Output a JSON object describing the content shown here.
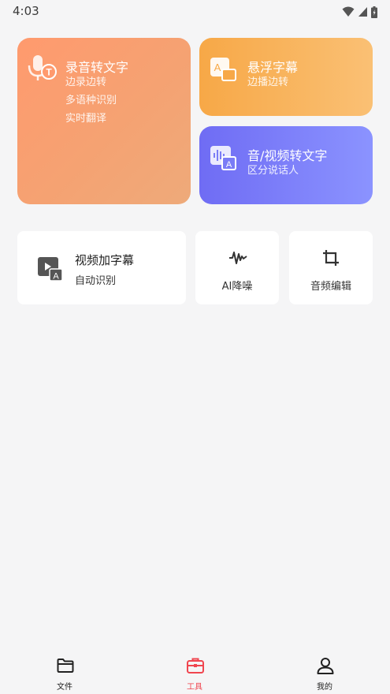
{
  "status_bar": {
    "time": "4:03"
  },
  "cards": {
    "record": {
      "title": "录音转文字",
      "lines": [
        "边录边转",
        "多语种识别",
        "实时翻译"
      ]
    },
    "float": {
      "title": "悬浮字幕",
      "subtitle": "边播边转"
    },
    "av": {
      "title": "音/视频转文字",
      "subtitle": "区分说话人"
    }
  },
  "tools": {
    "video_subtitle": {
      "title": "视频加字幕",
      "subtitle": "自动识别"
    },
    "ai_denoise": {
      "label": "AI降噪"
    },
    "audio_edit": {
      "label": "音频编辑"
    }
  },
  "bottom_nav": {
    "items": [
      {
        "label": "文件",
        "icon": "folder-icon"
      },
      {
        "label": "工具",
        "icon": "toolbox-icon"
      },
      {
        "label": "我的",
        "icon": "person-icon"
      }
    ],
    "active_index": 1
  },
  "colors": {
    "accent": "#f0454f",
    "record_card": "#ff9a6e",
    "float_card": "#f7a847",
    "av_card": "#6f6cf4"
  }
}
